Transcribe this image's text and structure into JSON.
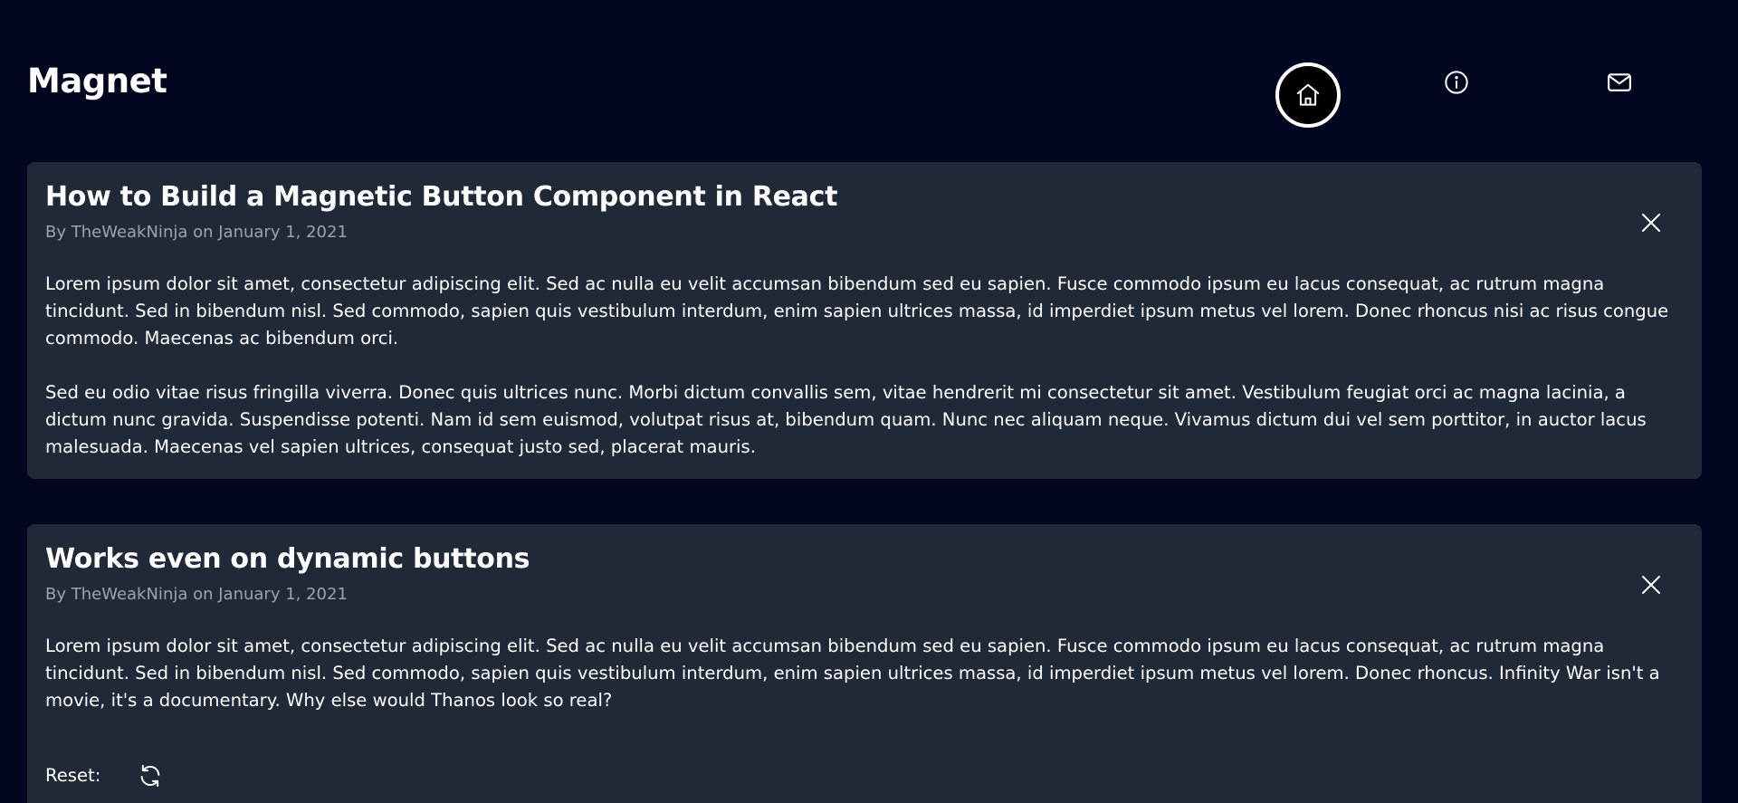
{
  "header": {
    "brand": "Magnet",
    "nav": [
      {
        "icon": "home-icon",
        "active": true
      },
      {
        "icon": "info-icon",
        "active": false
      },
      {
        "icon": "mail-icon",
        "active": false
      }
    ]
  },
  "articles": [
    {
      "title": "How to Build a Magnetic Button Component in React",
      "meta": "By TheWeakNinja on January 1, 2021",
      "paragraphs": [
        "Lorem ipsum dolor sit amet, consectetur adipiscing elit. Sed ac nulla eu velit accumsan bibendum sed eu sapien. Fusce commodo ipsum eu lacus consequat, ac rutrum magna tincidunt. Sed in bibendum nisl. Sed commodo, sapien quis vestibulum interdum, enim sapien ultrices massa, id imperdiet ipsum metus vel lorem. Donec rhoncus nisi ac risus congue commodo. Maecenas ac bibendum orci.",
        "Sed eu odio vitae risus fringilla viverra. Donec quis ultrices nunc. Morbi dictum convallis sem, vitae hendrerit mi consectetur sit amet. Vestibulum feugiat orci ac magna lacinia, a dictum nunc gravida. Suspendisse potenti. Nam id sem euismod, volutpat risus at, bibendum quam. Nunc nec aliquam neque. Vivamus dictum dui vel sem porttitor, in auctor lacus malesuada. Maecenas vel sapien ultrices, consequat justo sed, placerat mauris."
      ],
      "close_icon": "close-icon"
    },
    {
      "title": "Works even on dynamic buttons",
      "meta": "By TheWeakNinja on January 1, 2021",
      "paragraphs": [
        "Lorem ipsum dolor sit amet, consectetur adipiscing elit. Sed ac nulla eu velit accumsan bibendum sed eu sapien. Fusce commodo ipsum eu lacus consequat, ac rutrum magna tincidunt. Sed in bibendum nisl. Sed commodo, sapien quis vestibulum interdum, enim sapien ultrices massa, id imperdiet ipsum metus vel lorem. Donec rhoncus. Infinity War isn't a movie, it's a documentary. Why else would Thanos look so real?"
      ],
      "close_icon": "close-icon",
      "reset_label": "Reset:",
      "reset_icon": "refresh-icon"
    }
  ],
  "colors": {
    "background": "#000520",
    "card": "#1f2937",
    "meta_text": "#9ca3af",
    "text": "#ffffff",
    "active_nav": "#000000"
  }
}
